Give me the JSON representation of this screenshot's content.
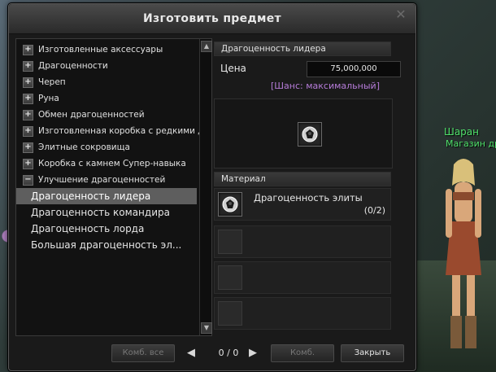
{
  "dialog": {
    "title": "Изготовить предмет",
    "close_icon": "close-icon"
  },
  "categories": [
    {
      "label": "Изготовленные аксессуары",
      "expanded": false
    },
    {
      "label": "Драгоценности",
      "expanded": false
    },
    {
      "label": "Череп",
      "expanded": false
    },
    {
      "label": "Руна",
      "expanded": false
    },
    {
      "label": "Обмен драгоценностей",
      "expanded": false
    },
    {
      "label": "Изготовленная коробка с редкими драгоценностями",
      "expanded": false
    },
    {
      "label": "Элитные сокровища",
      "expanded": false
    },
    {
      "label": "Коробка с камнем Супер-навыка",
      "expanded": false
    },
    {
      "label": "Улучшение драгоценностей",
      "expanded": true
    }
  ],
  "subitems": [
    {
      "label": "Драгоценность лидера",
      "selected": true
    },
    {
      "label": "Драгоценность командира",
      "selected": false
    },
    {
      "label": "Драгоценность лорда",
      "selected": false
    },
    {
      "label": "Большая драгоценность эл...",
      "selected": false
    }
  ],
  "result": {
    "header": "Драгоценность лидера",
    "price_label": "Цена",
    "price_value": "75,000,000",
    "chance": "[Шанс: максимальный]",
    "item_icon": "gem-icon"
  },
  "material": {
    "header": "Материал",
    "items": [
      {
        "name": "Драгоценность элиты",
        "count": "(0/2)",
        "icon": "gem-icon"
      }
    ]
  },
  "footer": {
    "combine_all": "Комб. все",
    "page": "0 / 0",
    "combine": "Комб.",
    "close": "Закрыть"
  },
  "world": {
    "npc_name": "Шаран",
    "npc_title": "Магазин драгоценностей"
  }
}
